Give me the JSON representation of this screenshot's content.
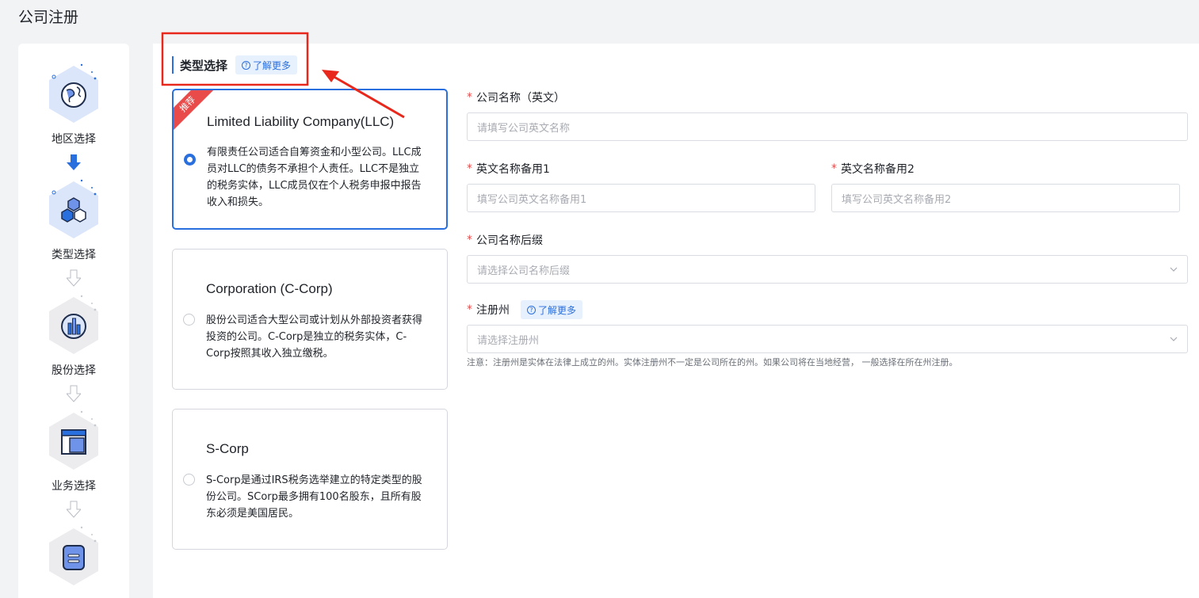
{
  "page": {
    "title": "公司注册"
  },
  "steps": [
    {
      "label": "地区选择",
      "icon": "globe-icon",
      "state": "done"
    },
    {
      "label": "类型选择",
      "icon": "hexagons-icon",
      "state": "active"
    },
    {
      "label": "股份选择",
      "icon": "bar-chart-icon",
      "state": "pending"
    },
    {
      "label": "业务选择",
      "icon": "layout-icon",
      "state": "pending"
    },
    {
      "label": "",
      "icon": "document-icon",
      "state": "pending"
    }
  ],
  "section": {
    "title": "类型选择",
    "learn_more": "了解更多"
  },
  "company_types": [
    {
      "title": "Limited Liability Company(LLC)",
      "badge": "推荐",
      "selected": true,
      "description": "有限责任公司适合自筹资金和小型公司。LLC成员对LLC的债务不承担个人责任。LLC不是独立的税务实体，LLC成员仅在个人税务申报中报告收入和损失。"
    },
    {
      "title": "Corporation (C-Corp)",
      "selected": false,
      "description": "股份公司适合大型公司或计划从外部投资者获得投资的公司。C-Corp是独立的税务实体，C-Corp按照其收入独立缴税。"
    },
    {
      "title": "S-Corp",
      "selected": false,
      "description": "S-Corp是通过IRS税务选举建立的特定类型的股份公司。SCorp最多拥有100名股东，且所有股东必须是美国居民。"
    }
  ],
  "form": {
    "required_mark": "*",
    "name_en": {
      "label": "公司名称（英文）",
      "placeholder": "请填写公司英文名称"
    },
    "alt1": {
      "label": "英文名称备用1",
      "placeholder": "填写公司英文名称备用1"
    },
    "alt2": {
      "label": "英文名称备用2",
      "placeholder": "填写公司英文名称备用2"
    },
    "suffix": {
      "label": "公司名称后缀",
      "placeholder": "请选择公司名称后缀"
    },
    "state": {
      "label": "注册州",
      "learn_more": "了解更多",
      "placeholder": "请选择注册州"
    },
    "note": "注意：注册州是实体在法律上成立的州。实体注册州不一定是公司所在的州。如果公司将在当地经营， 一般选择在所在州注册。"
  },
  "colors": {
    "primary": "#2a6fde",
    "required": "#e94b4b",
    "annotation": "#e8281c"
  }
}
